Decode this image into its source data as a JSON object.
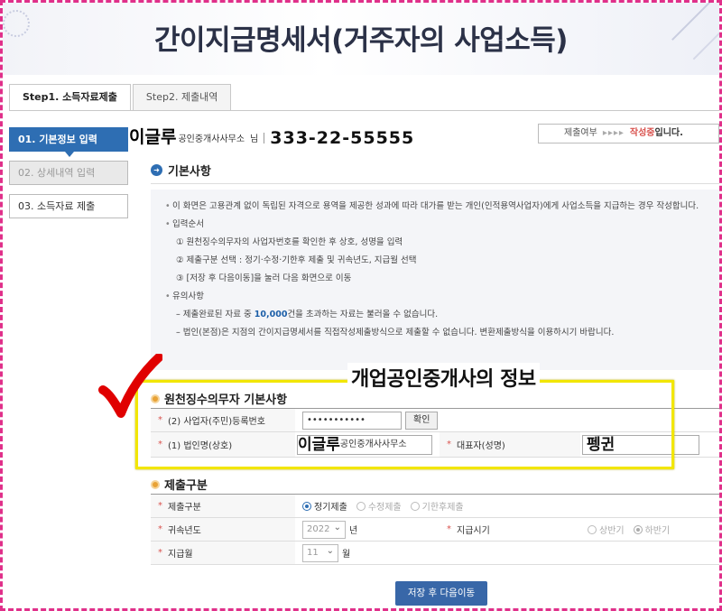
{
  "banner": {
    "title": "간이지급명세서(거주자의 사업소득)"
  },
  "tabs": [
    {
      "label": "Step1. 소득자료제출"
    },
    {
      "label": "Step2. 제출내역"
    }
  ],
  "sidebar": {
    "items": [
      {
        "label": "01. 기본정보 입력"
      },
      {
        "label": "02. 상세내역 입력"
      },
      {
        "label": "03. 소득자료 제출"
      }
    ]
  },
  "user": {
    "name_highlight": "이글루",
    "name_suffix": "공인중개사사무소",
    "honorific": "님",
    "biz_no": "333-22-55555"
  },
  "status": {
    "label": "제출여부",
    "arrows": "▸▸▸▸",
    "value": "작성중",
    "suffix": "입니다."
  },
  "basic": {
    "title": "기본사항",
    "info": {
      "p1": "이 화면은 고용관계 없이 독립된 자격으로 용역을 제공한 성과에 따라 대가를 받는 개인(인적용역사업자)에게 사업소득을 지급하는 경우 작성합니다.",
      "p2": "입력순서",
      "s1": "① 원천징수의무자의 사업자번호를 확인한 후 상호, 성명을 입력",
      "s2": "② 제출구분 선택 : 정기·수정·기한후 제출 및 귀속년도, 지급월 선택",
      "s3": "③ [저장 후 다음이동]을 눌러 다음 화면으로 이동",
      "p3": "유의사항",
      "n1_pre": "– 제출완료된 자료 중",
      "n1_num": "10,000",
      "n1_post": "건을 초과하는 자료는 불러올 수 없습니다.",
      "n2": "– 법인(본점)은 지점의 간이지급명세서를 직접작성제출방식으로 제출할 수 없습니다. 변환제출방식을 이용하시기 바랍니다."
    }
  },
  "annotation": {
    "banner": "개업공인중개사의 정보"
  },
  "withholder": {
    "title": "원천징수의무자 기본사항",
    "biz_label": "(2) 사업자(주민)등록번호",
    "biz_value": "•••••••••••",
    "confirm_btn": "확인",
    "corp_label": "(1) 법인명(상호)",
    "corp_highlight": "이글루",
    "corp_suffix": "공인중개사사무소",
    "rep_label": "대표자(성명)",
    "rep_value": "펭귄"
  },
  "submission": {
    "title": "제출구분",
    "type_label": "제출구분",
    "type_options": [
      "정기제출",
      "수정제출",
      "기한후제출"
    ],
    "year_label": "귀속년도",
    "year_value": "2022",
    "year_unit": "년",
    "period_label": "지급시기",
    "period_options": [
      "상반기",
      "하반기"
    ],
    "month_label": "지급월",
    "month_value": "11",
    "month_unit": "월"
  },
  "actions": {
    "save_next": "저장 후 다음이동"
  }
}
